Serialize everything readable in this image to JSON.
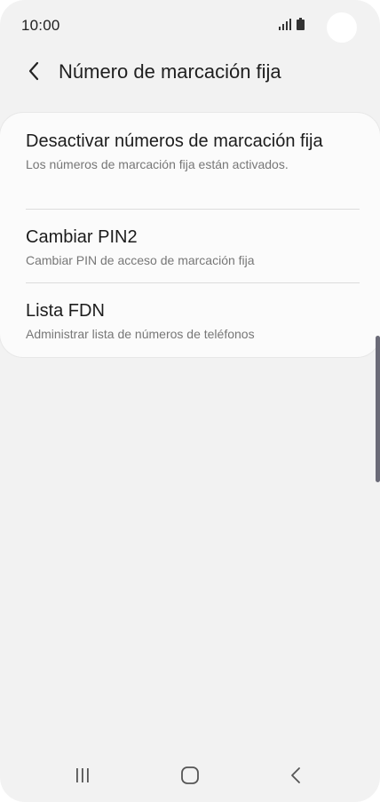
{
  "status_bar": {
    "time": "10:00"
  },
  "header": {
    "title": "Número de marcación fija"
  },
  "list": {
    "items": [
      {
        "title": "Desactivar números de marcación fija",
        "subtitle": "Los números de marcación fija están activados."
      },
      {
        "title": "Cambiar PIN2",
        "subtitle": "Cambiar PIN de acceso de marcación fija"
      },
      {
        "title": "Lista FDN",
        "subtitle": "Administrar lista de números de teléfonos"
      }
    ]
  },
  "nav": {
    "icons": [
      "recent-apps-icon",
      "home-icon",
      "back-icon"
    ]
  },
  "colors": {
    "background": "#f2f2f2",
    "card": "#fbfbfb",
    "scrollbar": "#6b6b78"
  }
}
